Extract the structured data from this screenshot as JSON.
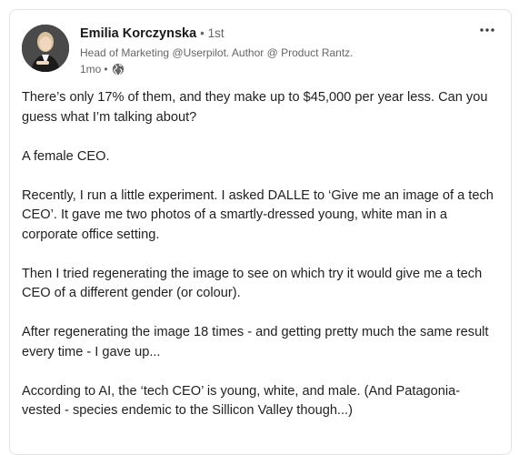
{
  "post": {
    "author": {
      "name": "Emilia Korczynska",
      "degree": "• 1st",
      "headline": "Head of Marketing @Userpilot. Author @ Product Rantz.",
      "time": "1mo",
      "visibility_sep": "•",
      "visibility_icon": "globe-icon"
    },
    "menu_icon": "more-horizontal-icon",
    "paragraphs": [
      "There’s only 17% of them, and they make up to $45,000 per year less. Can you guess what I’m talking about?",
      "A female CEO.",
      "Recently, I run a little experiment. I asked DALLE to ‘Give me an image of a tech CEO’. It gave me two photos of a smartly-dressed young, white man in a corporate office setting.",
      "Then I tried regenerating the image to see on which try it would give me a tech CEO of a different gender (or colour).",
      "After regenerating the image 18 times - and getting pretty much the same result every time - I gave up...",
      "According to AI, the ‘tech CEO’ is young, white, and male. (And Patagonia-vested - species endemic to the Sillicon Valley though...)"
    ]
  }
}
